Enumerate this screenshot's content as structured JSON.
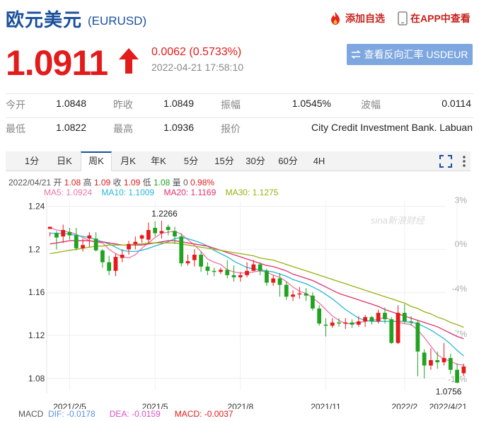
{
  "header": {
    "title": "欧元美元",
    "code": "(EURUSD)",
    "favorite_label": "添加自选",
    "app_label": "在APP中查看"
  },
  "quote": {
    "price": "1.0911",
    "change": "0.0062 (0.5733%)",
    "datetime": "2022-04-21 17:58:10",
    "reverse_label": "查看反向汇率 USDEUR"
  },
  "stats": [
    [
      {
        "label": "今开",
        "value": "1.0848"
      },
      {
        "label": "昨收",
        "value": "1.0849"
      },
      {
        "label": "振幅",
        "value": "1.0545%"
      },
      {
        "label": "波幅",
        "value": "0.0114"
      }
    ],
    [
      {
        "label": "最低",
        "value": "1.0822"
      },
      {
        "label": "最高",
        "value": "1.0936"
      },
      {
        "label": "报价",
        "value": "City Credit Investment Bank. Labuan"
      }
    ]
  ],
  "tabs": [
    "1分",
    "日K",
    "周K",
    "月K",
    "年K",
    "5分",
    "15分",
    "30分",
    "60分",
    "4H"
  ],
  "active_tab": "周K",
  "ohlc": {
    "date": "2022/04/21",
    "open_label": "开",
    "open": "1.08",
    "high_label": "高",
    "high": "1.09",
    "close_label": "收",
    "close": "1.09",
    "low_label": "低",
    "low": "1.08",
    "vol_label": "量",
    "vol": "0",
    "pct": "0.98%"
  },
  "ma": {
    "ma5": "MA5: 1.0924",
    "ma10": "MA10: 1.1009",
    "ma20": "MA20: 1.1169",
    "ma30": "MA30: 1.1275"
  },
  "macd": {
    "label": "MACD",
    "dif": "DIF: -0.0178",
    "dea": "DEA: -0.0159",
    "macd": "MACD: -0.0037"
  },
  "watermark": "sina新浪财经",
  "colors": {
    "up": "#e31b1b",
    "down": "#21a321",
    "brand": "#1a4f9c"
  },
  "chart_data": {
    "type": "candlestick",
    "y_ticks": [
      "1.24",
      "1.2",
      "1.16",
      "1.12",
      "1.08"
    ],
    "pct_ticks": [
      "3%",
      "0%",
      "-4%",
      "-7%",
      "-11%"
    ],
    "x_ticks": [
      "2021/2/5",
      "2021/5",
      "2021/8",
      "2021/11",
      "2022/2",
      "2022/4/21"
    ],
    "high_marker": "1.2266",
    "low_marker": "1.0756",
    "ylim": [
      1.07,
      1.245
    ],
    "candles": [
      [
        1.219,
        1.221,
        1.216,
        1.212
      ],
      [
        1.215,
        1.211,
        1.217,
        1.2
      ],
      [
        1.212,
        1.218,
        1.223,
        1.206
      ],
      [
        1.216,
        1.213,
        1.22,
        1.209
      ],
      [
        1.213,
        1.201,
        1.22,
        1.199
      ],
      [
        1.201,
        1.204,
        1.21,
        1.198
      ],
      [
        1.21,
        1.213,
        1.216,
        1.202
      ],
      [
        1.21,
        1.199,
        1.216,
        1.198
      ],
      [
        1.199,
        1.188,
        1.2,
        1.183
      ],
      [
        1.188,
        1.18,
        1.194,
        1.176
      ],
      [
        1.18,
        1.193,
        1.196,
        1.175
      ],
      [
        1.192,
        1.195,
        1.2,
        1.188
      ],
      [
        1.2,
        1.205,
        1.208,
        1.195
      ],
      [
        1.205,
        1.207,
        1.212,
        1.2
      ],
      [
        1.21,
        1.213,
        1.214,
        1.206
      ],
      [
        1.209,
        1.218,
        1.225,
        1.206
      ],
      [
        1.22,
        1.215,
        1.226,
        1.212
      ],
      [
        1.215,
        1.217,
        1.2266,
        1.21
      ],
      [
        1.221,
        1.218,
        1.223,
        1.213
      ],
      [
        1.217,
        1.212,
        1.221,
        1.205
      ],
      [
        1.212,
        1.187,
        1.215,
        1.184
      ],
      [
        1.187,
        1.189,
        1.195,
        1.185
      ],
      [
        1.19,
        1.195,
        1.2,
        1.184
      ],
      [
        1.195,
        1.184,
        1.198,
        1.179
      ],
      [
        1.184,
        1.18,
        1.188,
        1.176
      ],
      [
        1.18,
        1.179,
        1.183,
        1.175
      ],
      [
        1.179,
        1.181,
        1.183,
        1.177
      ],
      [
        1.181,
        1.176,
        1.19,
        1.173
      ],
      [
        1.176,
        1.174,
        1.185,
        1.17
      ],
      [
        1.174,
        1.176,
        1.179,
        1.17
      ],
      [
        1.176,
        1.18,
        1.188,
        1.174
      ],
      [
        1.18,
        1.186,
        1.19,
        1.18
      ],
      [
        1.186,
        1.18,
        1.188,
        1.176
      ],
      [
        1.18,
        1.169,
        1.182,
        1.166
      ],
      [
        1.169,
        1.173,
        1.176,
        1.166
      ],
      [
        1.173,
        1.167,
        1.178,
        1.156
      ],
      [
        1.167,
        1.156,
        1.17,
        1.153
      ],
      [
        1.156,
        1.158,
        1.162,
        1.152
      ],
      [
        1.158,
        1.159,
        1.165,
        1.154
      ],
      [
        1.159,
        1.157,
        1.164,
        1.152
      ],
      [
        1.157,
        1.145,
        1.16,
        1.143
      ],
      [
        1.145,
        1.131,
        1.148,
        1.129
      ],
      [
        1.13,
        1.129,
        1.136,
        1.119
      ],
      [
        1.129,
        1.132,
        1.136,
        1.127
      ],
      [
        1.132,
        1.131,
        1.136,
        1.128
      ],
      [
        1.131,
        1.132,
        1.136,
        1.126
      ],
      [
        1.132,
        1.13,
        1.135,
        1.127
      ],
      [
        1.13,
        1.133,
        1.138,
        1.128
      ],
      [
        1.133,
        1.137,
        1.139,
        1.128
      ],
      [
        1.137,
        1.133,
        1.138,
        1.13
      ],
      [
        1.133,
        1.141,
        1.144,
        1.131
      ],
      [
        1.141,
        1.135,
        1.146,
        1.131
      ],
      [
        1.135,
        1.113,
        1.137,
        1.112
      ],
      [
        1.113,
        1.141,
        1.148,
        1.112
      ],
      [
        1.141,
        1.133,
        1.149,
        1.131
      ],
      [
        1.133,
        1.132,
        1.138,
        1.129
      ],
      [
        1.132,
        1.105,
        1.134,
        1.082
      ],
      [
        1.104,
        1.092,
        1.107,
        1.08
      ],
      [
        1.092,
        1.097,
        1.108,
        1.088
      ],
      [
        1.097,
        1.095,
        1.105,
        1.089
      ],
      [
        1.095,
        1.099,
        1.113,
        1.092
      ],
      [
        1.099,
        1.088,
        1.103,
        1.084
      ],
      [
        1.088,
        1.076,
        1.094,
        1.0756
      ],
      [
        1.0848,
        1.0911,
        1.0936,
        1.0822
      ]
    ],
    "series": [
      {
        "name": "MA5",
        "color": "#e977a6",
        "values": [
          1.22,
          1.218,
          1.217,
          1.216,
          1.214,
          1.211,
          1.208,
          1.207,
          1.206,
          1.2,
          1.196,
          1.193,
          1.192,
          1.195,
          1.201,
          1.206,
          1.211,
          1.215,
          1.216,
          1.217,
          1.214,
          1.209,
          1.204,
          1.198,
          1.191,
          1.188,
          1.186,
          1.181,
          1.179,
          1.178,
          1.178,
          1.179,
          1.18,
          1.179,
          1.176,
          1.174,
          1.17,
          1.165,
          1.161,
          1.159,
          1.155,
          1.15,
          1.144,
          1.138,
          1.134,
          1.131,
          1.131,
          1.132,
          1.133,
          1.134,
          1.135,
          1.137,
          1.134,
          1.132,
          1.131,
          1.13,
          1.125,
          1.118,
          1.11,
          1.102,
          1.098,
          1.096,
          1.093,
          1.0924
        ]
      },
      {
        "name": "MA10",
        "color": "#29b7d6",
        "values": [
          1.215,
          1.215,
          1.215,
          1.214,
          1.213,
          1.212,
          1.211,
          1.209,
          1.207,
          1.205,
          1.202,
          1.199,
          1.198,
          1.198,
          1.199,
          1.201,
          1.203,
          1.205,
          1.207,
          1.21,
          1.211,
          1.21,
          1.208,
          1.206,
          1.203,
          1.199,
          1.196,
          1.193,
          1.189,
          1.186,
          1.183,
          1.182,
          1.181,
          1.18,
          1.179,
          1.177,
          1.175,
          1.172,
          1.17,
          1.168,
          1.165,
          1.162,
          1.158,
          1.154,
          1.149,
          1.144,
          1.14,
          1.136,
          1.134,
          1.133,
          1.133,
          1.133,
          1.133,
          1.133,
          1.133,
          1.132,
          1.131,
          1.128,
          1.125,
          1.121,
          1.117,
          1.112,
          1.106,
          1.1009
        ]
      },
      {
        "name": "MA20",
        "color": "#e0316e",
        "values": [
          1.205,
          1.206,
          1.207,
          1.208,
          1.208,
          1.208,
          1.208,
          1.207,
          1.207,
          1.206,
          1.205,
          1.204,
          1.204,
          1.204,
          1.204,
          1.205,
          1.206,
          1.207,
          1.208,
          1.208,
          1.207,
          1.206,
          1.205,
          1.204,
          1.203,
          1.201,
          1.199,
          1.197,
          1.195,
          1.193,
          1.191,
          1.189,
          1.187,
          1.185,
          1.184,
          1.182,
          1.18,
          1.177,
          1.175,
          1.173,
          1.171,
          1.168,
          1.165,
          1.162,
          1.159,
          1.157,
          1.155,
          1.153,
          1.151,
          1.149,
          1.147,
          1.144,
          1.142,
          1.14,
          1.138,
          1.136,
          1.134,
          1.132,
          1.13,
          1.128,
          1.125,
          1.122,
          1.119,
          1.1169
        ]
      },
      {
        "name": "MA30",
        "color": "#99b012",
        "values": [
          1.196,
          1.197,
          1.198,
          1.199,
          1.2,
          1.201,
          1.202,
          1.203,
          1.203,
          1.204,
          1.204,
          1.204,
          1.204,
          1.205,
          1.205,
          1.206,
          1.206,
          1.206,
          1.206,
          1.206,
          1.205,
          1.204,
          1.203,
          1.202,
          1.201,
          1.2,
          1.199,
          1.198,
          1.197,
          1.196,
          1.195,
          1.194,
          1.192,
          1.191,
          1.19,
          1.188,
          1.186,
          1.184,
          1.182,
          1.18,
          1.178,
          1.176,
          1.174,
          1.172,
          1.17,
          1.168,
          1.166,
          1.164,
          1.162,
          1.16,
          1.158,
          1.156,
          1.154,
          1.152,
          1.15,
          1.147,
          1.145,
          1.142,
          1.14,
          1.137,
          1.135,
          1.132,
          1.13,
          1.1275
        ]
      }
    ]
  }
}
